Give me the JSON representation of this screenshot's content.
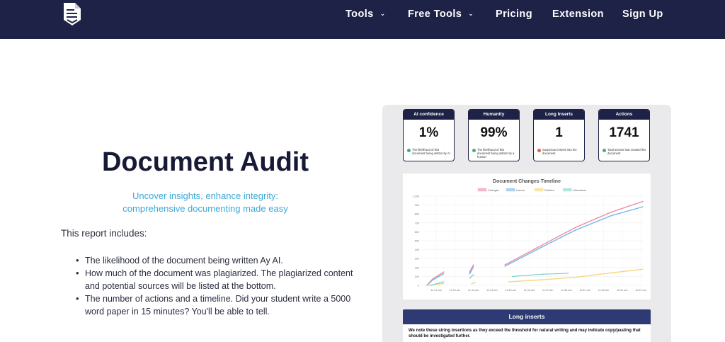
{
  "nav": {
    "tools": "Tools",
    "free_tools": "Free Tools",
    "pricing": "Pricing",
    "extension": "Extension",
    "sign_up": "Sign Up"
  },
  "hero": {
    "title": "Document Audit",
    "tagline_line1": "Uncover insights, enhance integrity:",
    "tagline_line2": "comprehensive documenting made easy",
    "includes": "This report includes:",
    "bullets": [
      "The likelihood of the document being written Ay AI.",
      "How much of the document was plagiarized. The plagiarized content and potential sources will be listed at the bottom.",
      "The number of actions and a timeline. Did your student write a 5000 word paper in 15 minutes? You'll be able to tell."
    ]
  },
  "stats": [
    {
      "title": "AI confidence",
      "value": "1%",
      "desc": "The likelihood of this document being written by AI",
      "dot_color": "#3cb371"
    },
    {
      "title": "Humanity",
      "value": "99%",
      "desc": "The likelihood of this document being written by a human",
      "dot_color": "#3cb371"
    },
    {
      "title": "Long Inserts",
      "value": "1",
      "desc": "Suspicious inserts into the document",
      "dot_color": "#e8613c"
    },
    {
      "title": "Actions",
      "value": "1741",
      "desc": "Total actions that created this document",
      "dot_color": "#3cb371"
    }
  ],
  "chart_data": {
    "type": "scatter",
    "title": "Document Changes Timeline",
    "legend_position": "top",
    "grid": true,
    "x": [
      "11:41 am",
      "11:42 am",
      "11:43 am",
      "11:44 am",
      "11:45 am",
      "11:46 am",
      "11:47 am",
      "11:48 am",
      "11:49 am",
      "11:50 am",
      "11:51 am",
      "11:52 am"
    ],
    "ylim": [
      0,
      1000
    ],
    "yticks": [
      "0",
      "100",
      "200",
      "300",
      "400",
      "500",
      "600",
      "700",
      "800",
      "900",
      "1,000"
    ],
    "series": [
      {
        "name": "Changes",
        "color": "#f08aa0",
        "segments": [
          [
            [
              0.0,
              0
            ],
            [
              0.3,
              70
            ],
            [
              0.9,
              150
            ]
          ],
          [
            [
              2.3,
              150
            ],
            [
              2.5,
              230
            ]
          ],
          [
            [
              4.2,
              230
            ],
            [
              6.0,
              430
            ],
            [
              8.0,
              650
            ],
            [
              9.9,
              820
            ],
            [
              11.6,
              940
            ]
          ]
        ]
      },
      {
        "name": "Inserts",
        "color": "#6fb8ea",
        "segments": [
          [
            [
              0.0,
              0
            ],
            [
              0.3,
              60
            ],
            [
              0.9,
              130
            ]
          ],
          [
            [
              2.3,
              130
            ],
            [
              2.5,
              210
            ]
          ],
          [
            [
              4.2,
              215
            ],
            [
              6.0,
              410
            ],
            [
              8.0,
              620
            ],
            [
              9.9,
              780
            ],
            [
              11.6,
              880
            ]
          ]
        ]
      },
      {
        "name": "Deletes",
        "color": "#f5d36b",
        "segments": [
          [
            [
              0.0,
              0
            ],
            [
              0.9,
              20
            ]
          ],
          [
            [
              2.4,
              20
            ],
            [
              2.6,
              30
            ]
          ],
          [
            [
              4.4,
              40
            ],
            [
              6.0,
              60
            ],
            [
              8.0,
              90
            ],
            [
              9.9,
              140
            ],
            [
              11.6,
              180
            ]
          ]
        ]
      },
      {
        "name": "Alterations",
        "color": "#7fd3c8",
        "segments": [
          [
            [
              0.2,
              0
            ],
            [
              0.9,
              40
            ]
          ],
          [
            [
              2.3,
              80
            ],
            [
              2.5,
              120
            ]
          ],
          [
            [
              4.6,
              100
            ],
            [
              6.2,
              125
            ],
            [
              7.6,
              135
            ]
          ]
        ]
      }
    ]
  },
  "long_inserts": {
    "title": "Long inserts",
    "text": "We note these string insertions as they exceed the threshold for natural writing and may indicate copy/pasting that should be investigated further."
  }
}
